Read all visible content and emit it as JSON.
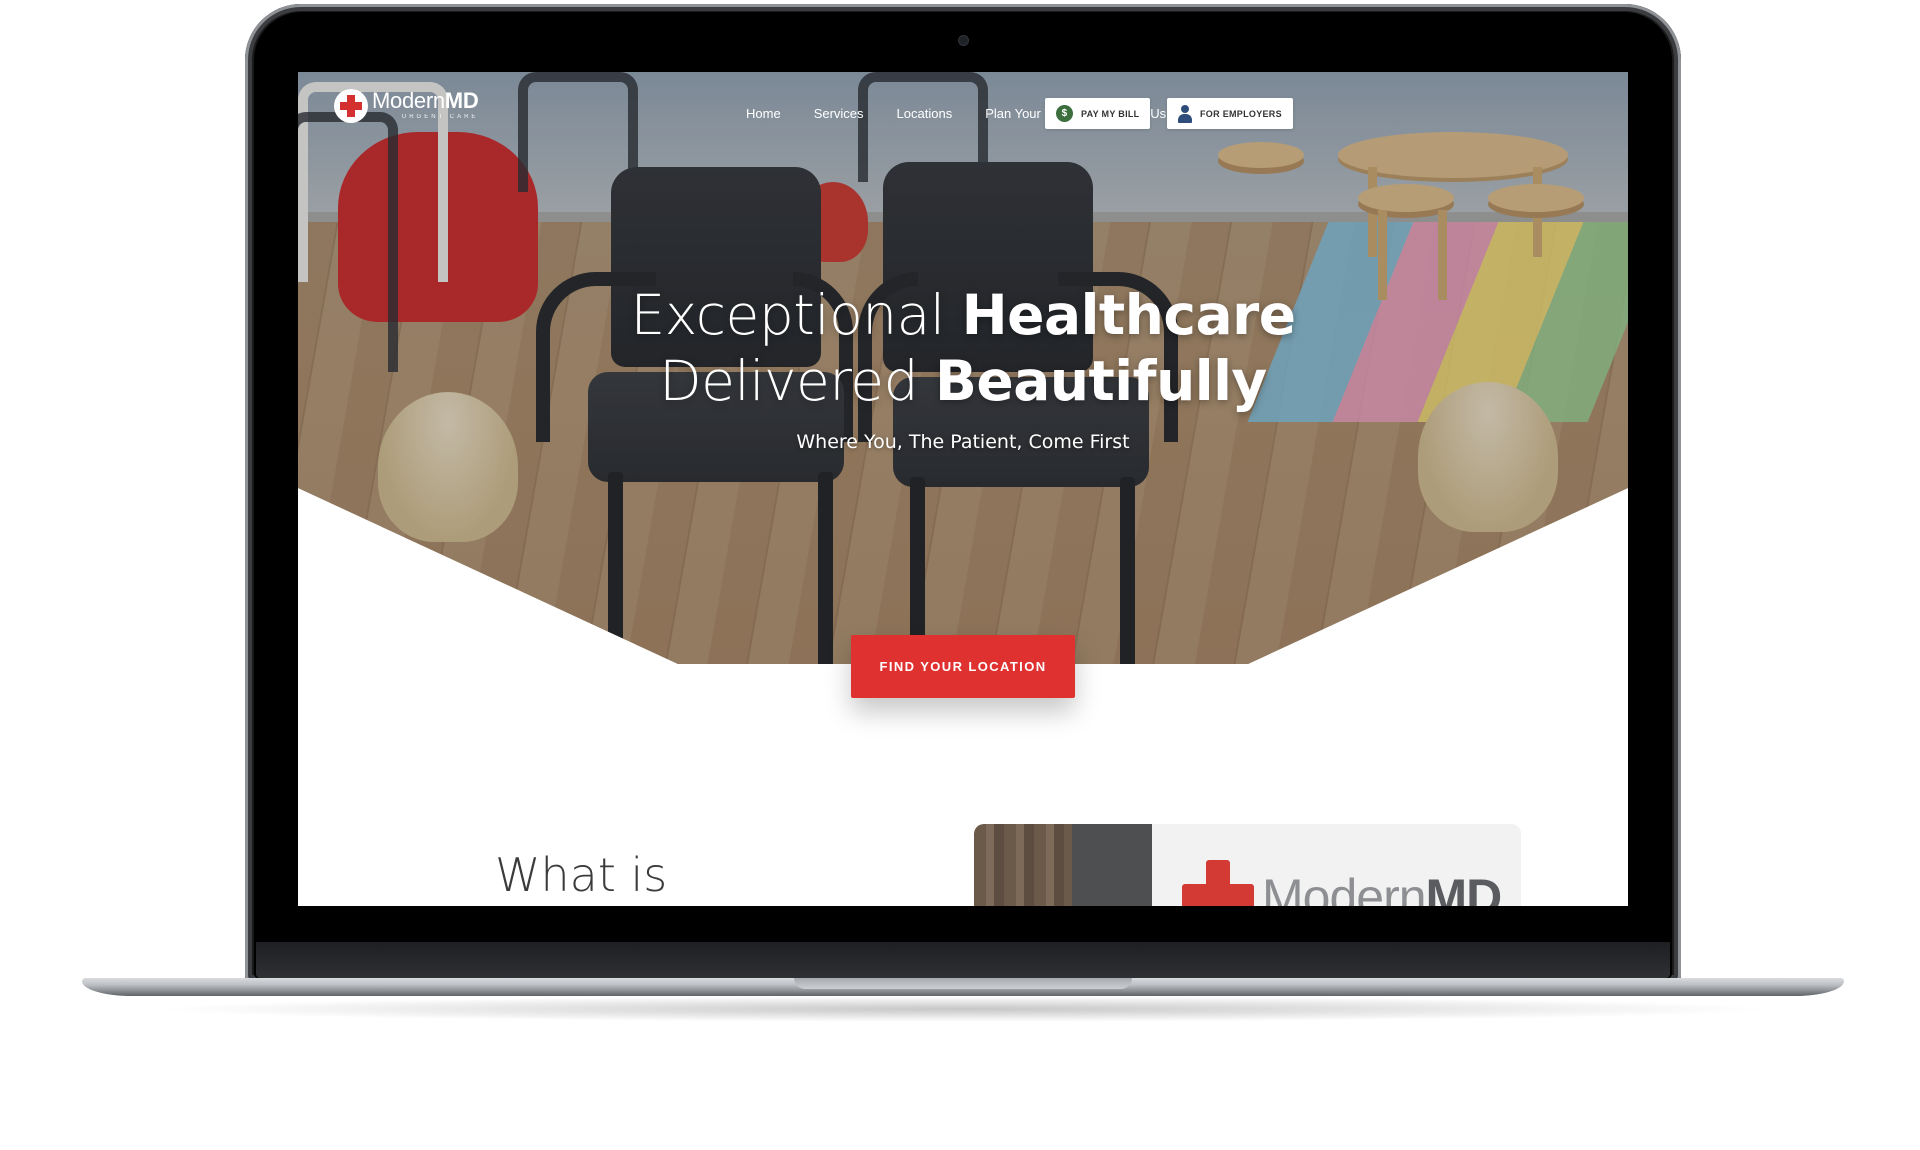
{
  "header": {
    "logo": {
      "name_regular": "Modern",
      "name_bold": "MD",
      "tagline": "URGENT CARE"
    },
    "nav": [
      "Home",
      "Services",
      "Locations",
      "Plan Your Visit",
      "Contact Us"
    ],
    "pay_bill_label": "PAY MY BILL",
    "employers_label": "FOR EMPLOYERS"
  },
  "hero": {
    "title_line1_regular": "Exceptional ",
    "title_line1_bold": "Healthcare",
    "title_line2_regular": "Delivered ",
    "title_line2_bold": "Beautifully",
    "subtitle": "Where You, The Patient, Come First",
    "cta_label": "FIND YOUR LOCATION"
  },
  "section": {
    "heading": "What is",
    "image_sign_regular": "Modern",
    "image_sign_bold": "MD"
  },
  "colors": {
    "accent_red": "#e03131",
    "brand_red": "#d3302f",
    "bill_icon_green": "#3c6e3e",
    "employer_icon_blue": "#2f4d7a"
  },
  "icons": {
    "logo": "medical-cross-icon",
    "pay_bill": "dollar-coin-icon",
    "employers": "person-icon"
  }
}
